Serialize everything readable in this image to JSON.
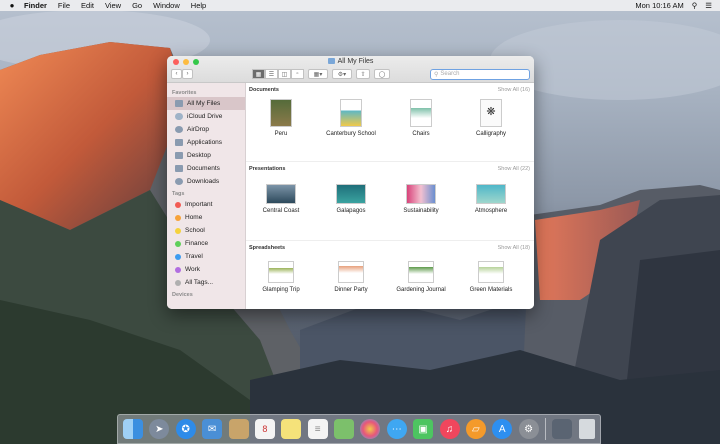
{
  "menubar": {
    "apple": "",
    "items": [
      "Finder",
      "File",
      "Edit",
      "View",
      "Go",
      "Window",
      "Help"
    ],
    "clock": "Mon 10:16 AM"
  },
  "window": {
    "title": "All My Files",
    "search_placeholder": "Search"
  },
  "sidebar": {
    "favorites_header": "Favorites",
    "favorites": [
      {
        "label": "All My Files",
        "icon": "all-files-icon",
        "selected": true
      },
      {
        "label": "iCloud Drive",
        "icon": "cloud-icon"
      },
      {
        "label": "AirDrop",
        "icon": "airdrop-icon"
      },
      {
        "label": "Applications",
        "icon": "applications-icon"
      },
      {
        "label": "Desktop",
        "icon": "desktop-icon"
      },
      {
        "label": "Documents",
        "icon": "documents-icon"
      },
      {
        "label": "Downloads",
        "icon": "downloads-icon"
      }
    ],
    "tags_header": "Tags",
    "tags": [
      {
        "label": "Important",
        "color": "#f25c54"
      },
      {
        "label": "Home",
        "color": "#f7a33a"
      },
      {
        "label": "School",
        "color": "#f5d23c"
      },
      {
        "label": "Finance",
        "color": "#5fcf5a"
      },
      {
        "label": "Travel",
        "color": "#3e9cf0"
      },
      {
        "label": "Work",
        "color": "#b16ee0"
      },
      {
        "label": "All Tags...",
        "color": "#b0b0b0"
      }
    ],
    "devices_header": "Devices"
  },
  "sections": [
    {
      "title": "Documents",
      "show_all": "Show All (16)",
      "files": [
        "Peru",
        "Canterbury School",
        "Chairs",
        "Calligraphy"
      ]
    },
    {
      "title": "Presentations",
      "show_all": "Show All (22)",
      "files": [
        "Central Coast",
        "Galapagos",
        "Sustainability",
        "Atmosphere"
      ]
    },
    {
      "title": "Spreadsheets",
      "show_all": "Show All (18)",
      "files": [
        "Glamping Trip",
        "Dinner Party",
        "Gardening Journal",
        "Green Materials"
      ]
    }
  ],
  "dock": [
    {
      "name": "finder-icon",
      "color": "#3b8fe0"
    },
    {
      "name": "launchpad-icon",
      "color": "#7d8a9c"
    },
    {
      "name": "safari-icon",
      "color": "#2e8be8"
    },
    {
      "name": "mail-icon",
      "color": "#4a8fd6"
    },
    {
      "name": "contacts-icon",
      "color": "#c8a46a"
    },
    {
      "name": "calendar-icon",
      "color": "#f4f4f4",
      "text": "8"
    },
    {
      "name": "notes-icon",
      "color": "#f5e27a"
    },
    {
      "name": "reminders-icon",
      "color": "#f4f4f4"
    },
    {
      "name": "maps-icon",
      "color": "#7cc06b"
    },
    {
      "name": "photos-icon",
      "color": "#f2f2f2"
    },
    {
      "name": "messages-icon",
      "color": "#3fa7f2"
    },
    {
      "name": "facetime-icon",
      "color": "#4dc561"
    },
    {
      "name": "itunes-icon",
      "color": "#f0465d"
    },
    {
      "name": "ibooks-icon",
      "color": "#f49a2b"
    },
    {
      "name": "app-store-icon",
      "color": "#2d8ff0"
    },
    {
      "name": "system-preferences-icon",
      "color": "#8b8f96"
    },
    {
      "name": "separator"
    },
    {
      "name": "downloads-stack-icon",
      "color": "#5a6472"
    },
    {
      "name": "trash-icon",
      "color": "#d6dade"
    }
  ]
}
